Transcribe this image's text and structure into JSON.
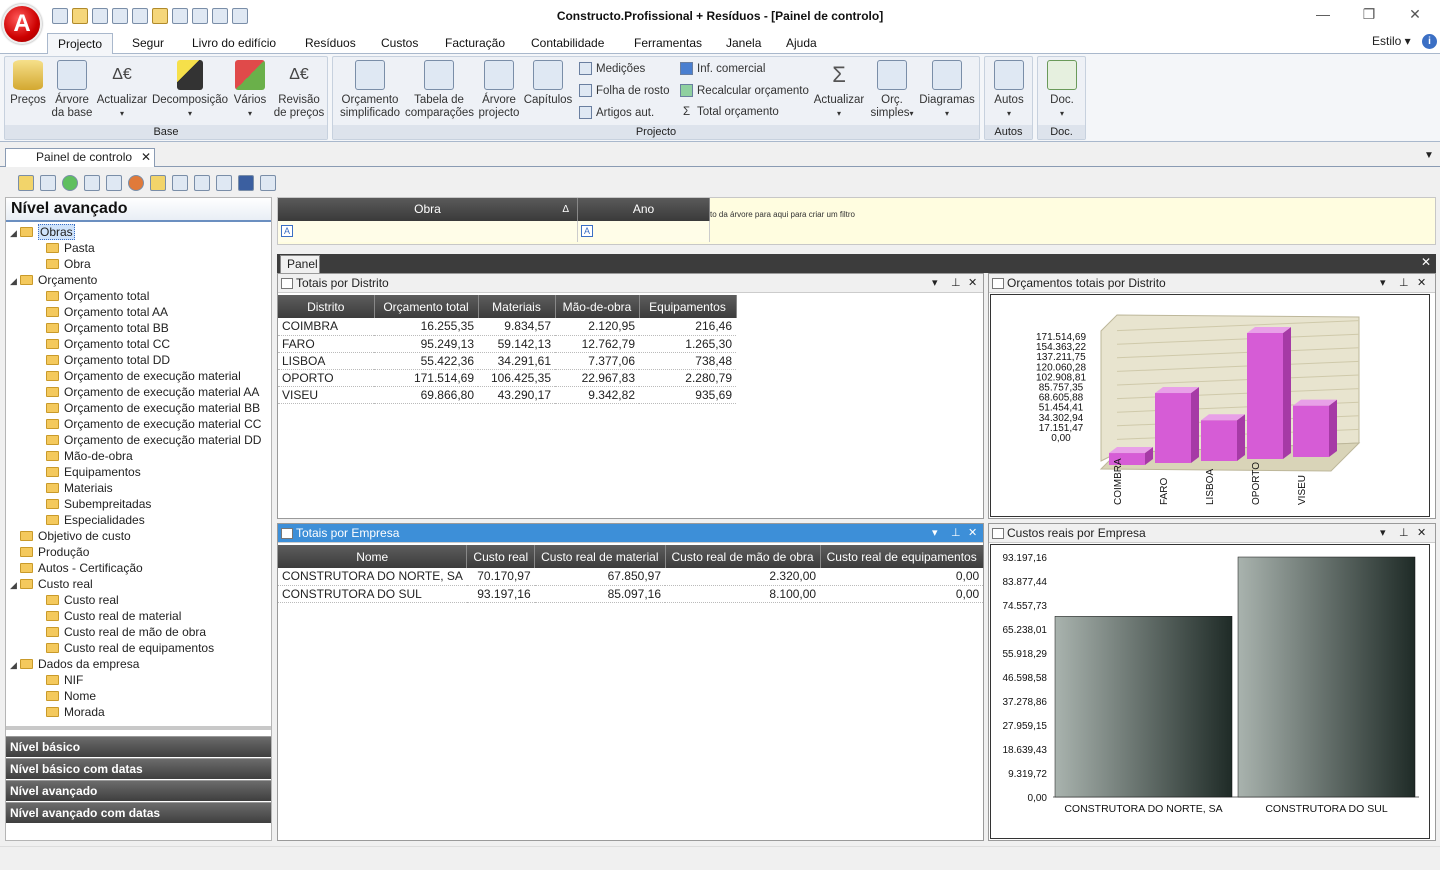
{
  "window": {
    "title": "Constructo.Profissional + Resíduos - [Painel de controlo]",
    "logo_letter": "A",
    "controls": {
      "minimize": "—",
      "restore": "❐",
      "close": "✕"
    }
  },
  "menu": {
    "tabs": [
      "Projecto",
      "Segur",
      "Livro do edifício",
      "Resíduos",
      "Custos",
      "Facturação",
      "Contabilidade",
      "Ferramentas",
      "Janela",
      "Ajuda"
    ],
    "active": "Projecto",
    "style_label": "Estilo"
  },
  "ribbon": {
    "groups": {
      "base": "Base",
      "projecto": "Projecto",
      "autos": "Autos",
      "doc": "Doc."
    },
    "buttons": {
      "precos": "Preços",
      "arvore_base_1": "Árvore",
      "arvore_base_2": "da base",
      "actualizar": "Actualizar",
      "decomposicao": "Decomposição",
      "varios": "Vários",
      "revisao_1": "Revisão",
      "revisao_2": "de preços",
      "orcamento_1": "Orçamento",
      "orcamento_2": "simplificado",
      "tabela_1": "Tabela de",
      "tabela_2": "comparações",
      "arvore_proj_1": "Árvore",
      "arvore_proj_2": "projecto",
      "capitulos": "Capítulos",
      "medicoes": "Medições",
      "folha_rosto": "Folha de rosto",
      "artigos_aut": "Artigos aut.",
      "inf_comercial": "Inf. comercial",
      "recalcular": "Recalcular orçamento",
      "total_orcamento": "Total orçamento",
      "actualizar_proj": "Actualizar",
      "orc_simples_1": "Orç.",
      "orc_simples_2": "simples",
      "diagramas": "Diagramas",
      "autos": "Autos",
      "doc": "Doc."
    }
  },
  "document_tab": {
    "label": "Painel de controlo",
    "close": "✕"
  },
  "left_panel": {
    "header": "Nível avançado",
    "tree": [
      {
        "label": "Obras",
        "level": 0,
        "expanded": true,
        "selected": true
      },
      {
        "label": "Pasta",
        "level": 1
      },
      {
        "label": "Obra",
        "level": 1
      },
      {
        "label": "Orçamento",
        "level": 0,
        "expanded": true
      },
      {
        "label": "Orçamento total",
        "level": 1
      },
      {
        "label": "Orçamento total AA",
        "level": 1
      },
      {
        "label": "Orçamento total BB",
        "level": 1
      },
      {
        "label": "Orçamento total CC",
        "level": 1
      },
      {
        "label": "Orçamento total DD",
        "level": 1
      },
      {
        "label": "Orçamento de execução material",
        "level": 1
      },
      {
        "label": "Orçamento de execução material AA",
        "level": 1
      },
      {
        "label": "Orçamento de execução material BB",
        "level": 1
      },
      {
        "label": "Orçamento de execução material CC",
        "level": 1
      },
      {
        "label": "Orçamento de execução material DD",
        "level": 1
      },
      {
        "label": "Mão-de-obra",
        "level": 1
      },
      {
        "label": "Equipamentos",
        "level": 1
      },
      {
        "label": "Materiais",
        "level": 1
      },
      {
        "label": "Subempreitadas",
        "level": 1
      },
      {
        "label": "Especialidades",
        "level": 1
      },
      {
        "label": "Objetivo de custo",
        "level": 0
      },
      {
        "label": "Produção",
        "level": 0
      },
      {
        "label": "Autos - Certificação",
        "level": 0
      },
      {
        "label": "Custo real",
        "level": 0,
        "expanded": true
      },
      {
        "label": "Custo real",
        "level": 1
      },
      {
        "label": "Custo real de material",
        "level": 1
      },
      {
        "label": "Custo real de mão de obra",
        "level": 1
      },
      {
        "label": "Custo real de equipamentos",
        "level": 1
      },
      {
        "label": "Dados da empresa",
        "level": 0,
        "expanded": true
      },
      {
        "label": "NIF",
        "level": 1
      },
      {
        "label": "Nome",
        "level": 1
      },
      {
        "label": "Morada",
        "level": 1
      }
    ],
    "nav_buttons": [
      "Nível básico",
      "Nível básico com datas",
      "Nível avançado",
      "Nível avançado com datas"
    ]
  },
  "filter": {
    "columns": [
      "Obra",
      "Ano"
    ],
    "hint": "to da árvore para aqui para criar um filtro",
    "sort_glyph": "Δ",
    "cell_glyph": "A"
  },
  "panel_tab": "Panel",
  "totais_distrito": {
    "title": "Totais por Distrito",
    "columns": [
      "Distrito",
      "Orçamento total",
      "Materiais",
      "Mão-de-obra",
      "Equipamentos"
    ],
    "rows": [
      [
        "COIMBRA",
        "16.255,35",
        "9.834,57",
        "2.120,95",
        "216,46"
      ],
      [
        "FARO",
        "95.249,13",
        "59.142,13",
        "12.762,79",
        "1.265,30"
      ],
      [
        "LISBOA",
        "55.422,36",
        "34.291,61",
        "7.377,06",
        "738,48"
      ],
      [
        "OPORTO",
        "171.514,69",
        "106.425,35",
        "22.967,83",
        "2.280,79"
      ],
      [
        "VISEU",
        "69.866,80",
        "43.290,17",
        "9.342,82",
        "935,69"
      ]
    ]
  },
  "totais_empresa": {
    "title": "Totais por Empresa",
    "columns": [
      "Nome",
      "Custo real",
      "Custo real de material",
      "Custo real de mão de obra",
      "Custo real de equipamentos"
    ],
    "rows": [
      [
        "CONSTRUTORA DO NORTE, SA",
        "70.170,97",
        "67.850,97",
        "2.320,00",
        "0,00"
      ],
      [
        "CONSTRUTORA DO SUL",
        "93.197,16",
        "85.097,16",
        "8.100,00",
        "0,00"
      ]
    ]
  },
  "panel_controls": {
    "dropdown": "▾",
    "pin": "⊥",
    "close": "✕"
  },
  "chart_data": [
    {
      "type": "bar",
      "title": "Orçamentos totais por Distrito",
      "categories": [
        "COIMBRA",
        "FARO",
        "LISBOA",
        "OPORTO",
        "VISEU"
      ],
      "values": [
        16255.35,
        95249.13,
        55422.36,
        171514.69,
        69866.8
      ],
      "ylim": [
        0,
        171514.69
      ],
      "yticks": [
        "171.514,69",
        "154.363,22",
        "137.211,75",
        "120.060,28",
        "102.908,81",
        "85.757,35",
        "68.605,88",
        "51.454,41",
        "34.302,94",
        "17.151,47",
        "0,00"
      ],
      "color": "#d65cd6",
      "style": "3d"
    },
    {
      "type": "bar",
      "title": "Custos reais por Empresa",
      "categories": [
        "CONSTRUTORA DO NORTE, SA",
        "CONSTRUTORA DO SUL"
      ],
      "values": [
        70170.97,
        93197.16
      ],
      "ylim": [
        0,
        93197.16
      ],
      "yticks": [
        "93.197,16",
        "83.877,44",
        "74.557,73",
        "65.238,01",
        "55.918,29",
        "46.598,58",
        "37.278,86",
        "27.959,15",
        "18.639,43",
        "9.319,72",
        "0,00"
      ],
      "color": "#1f2b27"
    }
  ]
}
